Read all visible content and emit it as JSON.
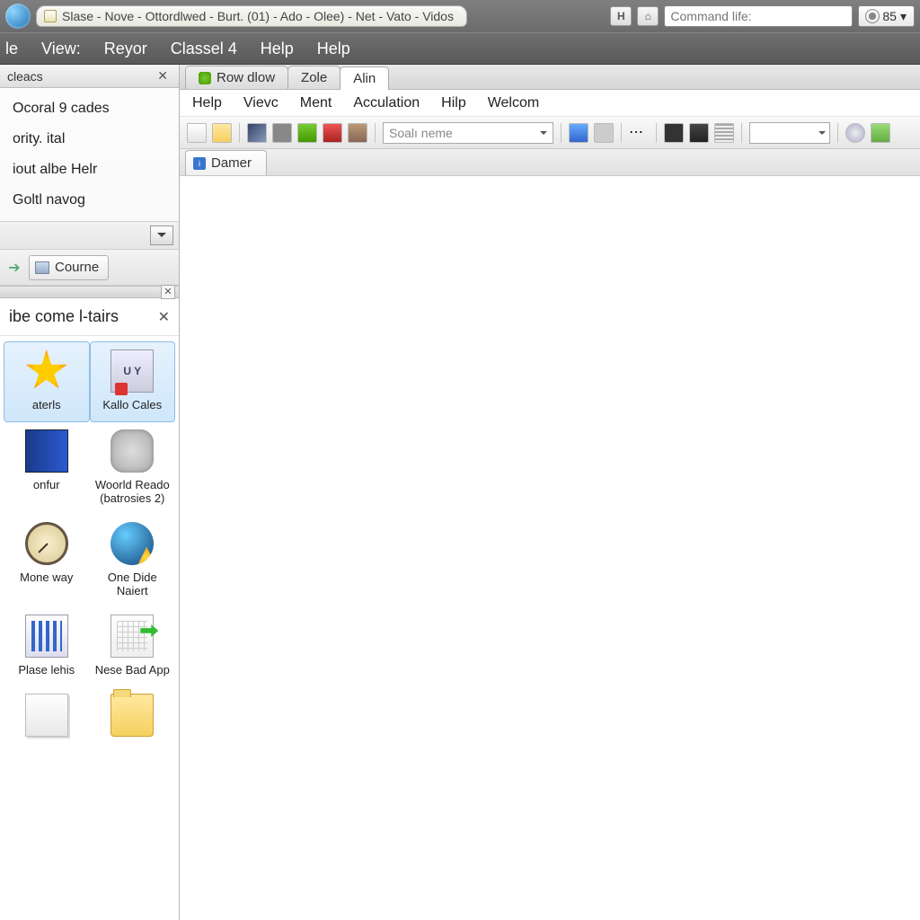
{
  "titlebar": {
    "title": "Slase - Nove - Ottordlwed - Burt. (01) - Ado - Olee) - Net - Vato - Vidos",
    "command_placeholder": "Command life:",
    "percent": "85"
  },
  "menubar": [
    "le",
    "View:",
    "Reyor",
    "Classel 4",
    "Help",
    "Help"
  ],
  "sidebar": {
    "panel1_title": "cleacs",
    "nav_items": [
      "Ocoral 9 cades",
      "ority. ital",
      "iout albe Helr",
      "Goltl navog"
    ],
    "button_label": "Courne",
    "panel2_title": "ibe come l-tairs",
    "tiles": [
      {
        "label": "aterls"
      },
      {
        "label": "Kallo Cales"
      },
      {
        "label": "onfur"
      },
      {
        "label": "Woorld Reado (batrosies 2)"
      },
      {
        "label": "Mone way"
      },
      {
        "label": "One Dide Naiert"
      },
      {
        "label": "Plase lehis"
      },
      {
        "label": "Nese Bad App"
      },
      {
        "label": ""
      },
      {
        "label": ""
      }
    ]
  },
  "main": {
    "doc_tabs": [
      {
        "label": "Row dlow"
      },
      {
        "label": "Zole"
      },
      {
        "label": "Alin",
        "active": true
      }
    ],
    "inner_menu": [
      "Help",
      "Vievc",
      "Ment",
      "Acculation",
      "Hilp",
      "Welcom"
    ],
    "toolbar": {
      "search_placeholder": "Soalı neme"
    },
    "content_tab": "Damer"
  }
}
